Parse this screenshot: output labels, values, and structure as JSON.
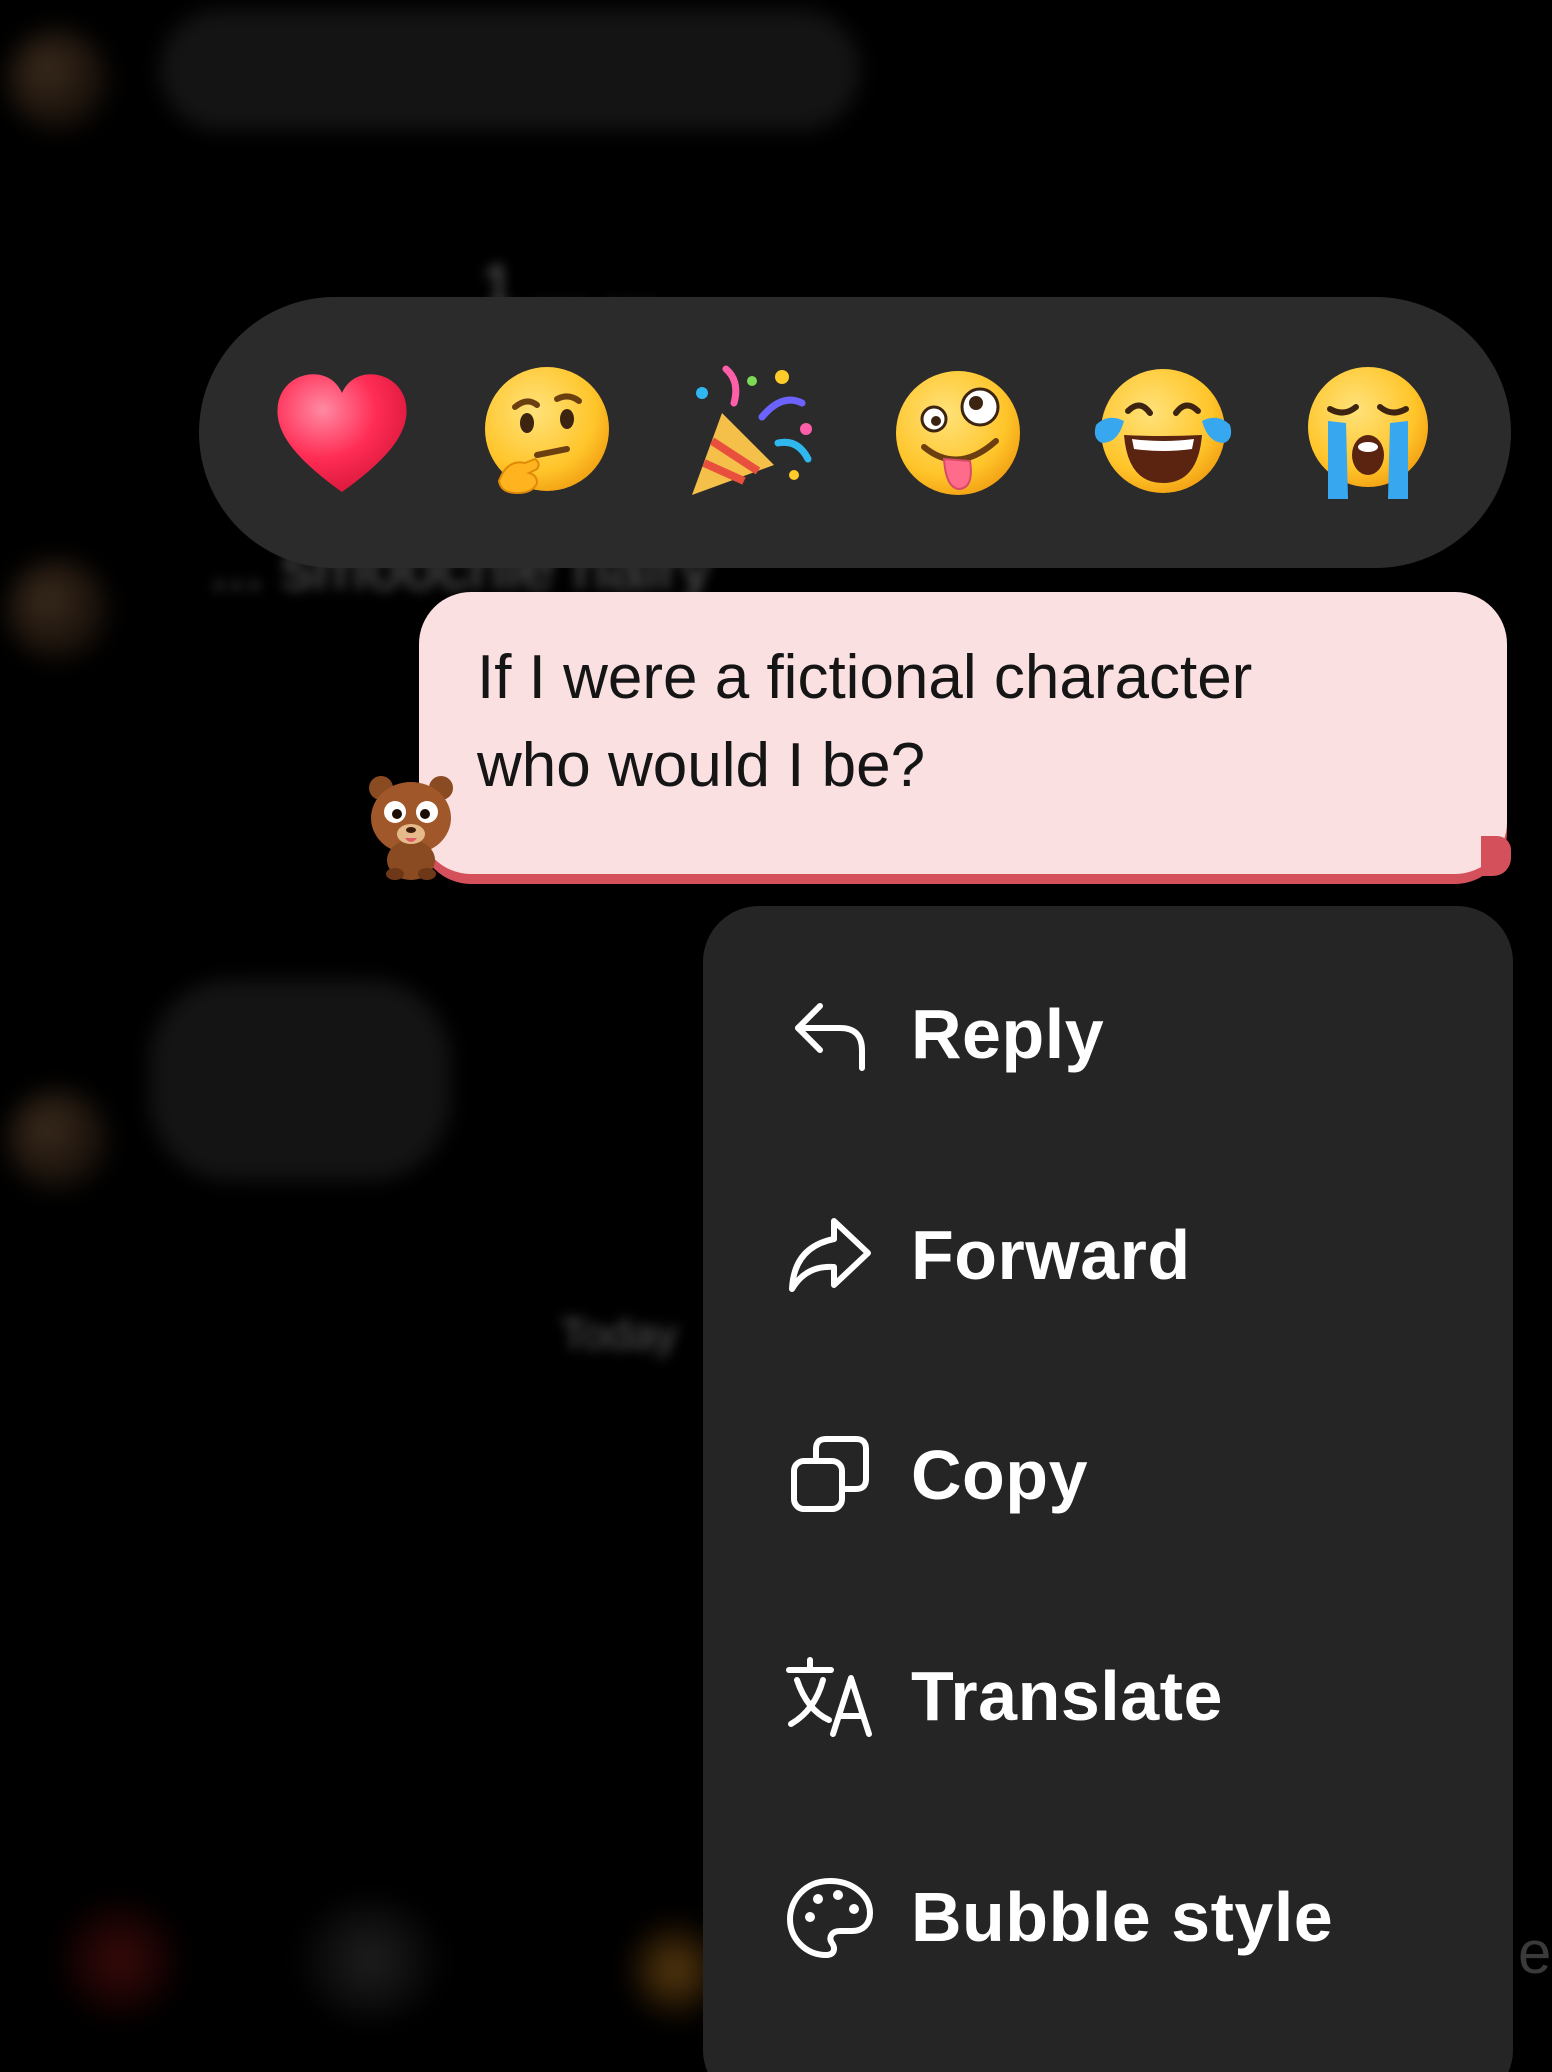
{
  "background_chat": {
    "partial_text_upper": "1 ... ...",
    "partial_text_behind_bar": "... smoochie hairy",
    "partial_text_mid": "Today"
  },
  "reactions": [
    {
      "name": "red-heart",
      "icon": "heart-emoji"
    },
    {
      "name": "thinking-face",
      "icon": "thinking-face-emoji"
    },
    {
      "name": "party-popper",
      "icon": "party-popper-emoji"
    },
    {
      "name": "zany-face",
      "icon": "zany-face-emoji"
    },
    {
      "name": "tears-of-joy",
      "icon": "tears-of-joy-emoji"
    },
    {
      "name": "loudly-crying",
      "icon": "loudly-crying-emoji"
    }
  ],
  "message": {
    "line1": "If I were a fictional character",
    "line2": "who would I be?",
    "bubble_color": "#fbe0e2",
    "accent_color": "#d4505a",
    "sender_icon": "bear-avatar-icon"
  },
  "menu": {
    "items": [
      {
        "label": "Reply",
        "icon": "reply-icon"
      },
      {
        "label": "Forward",
        "icon": "forward-icon"
      },
      {
        "label": "Copy",
        "icon": "copy-icon"
      },
      {
        "label": "Translate",
        "icon": "translate-icon"
      },
      {
        "label": "Bubble style",
        "icon": "palette-icon"
      }
    ],
    "background_color": "#252525"
  }
}
